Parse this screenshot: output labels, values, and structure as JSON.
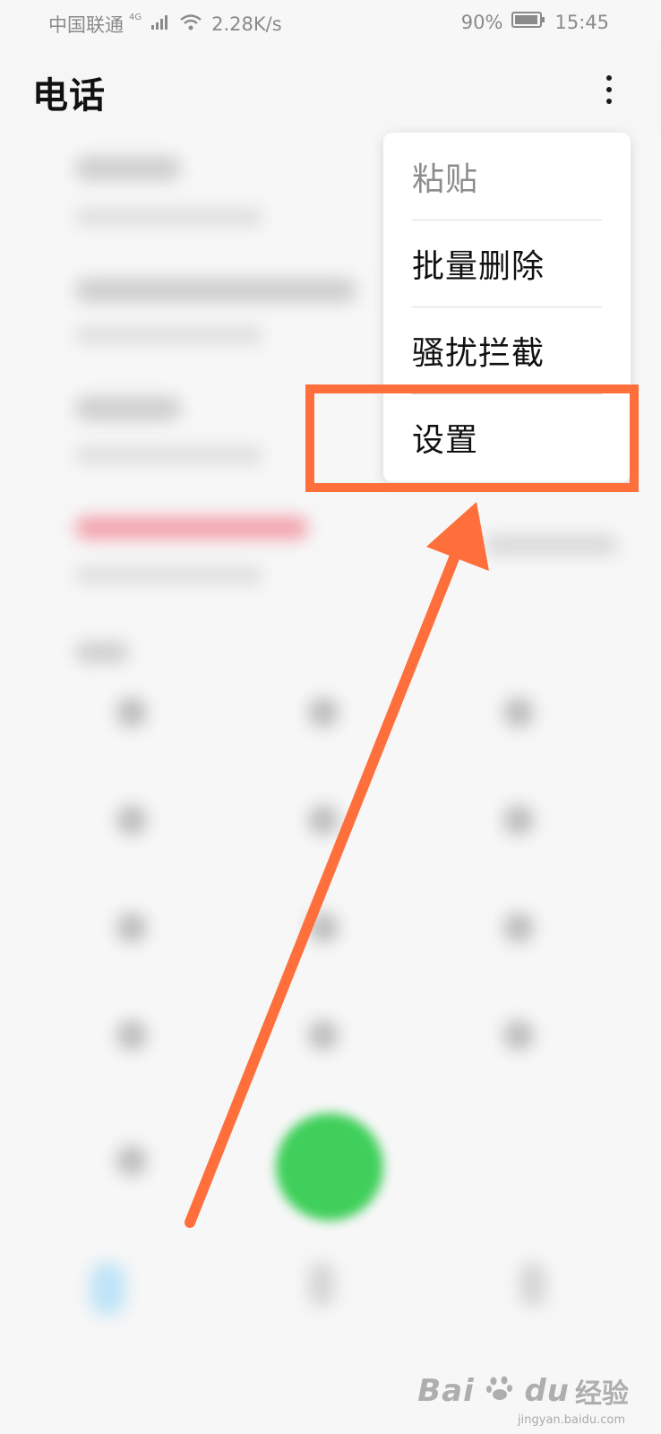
{
  "status_bar": {
    "carrier": "中国联通",
    "network_type": "4G",
    "speed": "2.28K/s",
    "battery": "90%",
    "time": "15:45"
  },
  "header": {
    "title": "电话",
    "more_icon": "more-vertical-icon"
  },
  "menu": {
    "items": [
      {
        "label": "粘贴",
        "enabled": false
      },
      {
        "label": "批量删除",
        "enabled": true
      },
      {
        "label": "骚扰拦截",
        "enabled": true
      },
      {
        "label": "设置",
        "enabled": true
      }
    ]
  },
  "annotation": {
    "color": "#ff6f3c",
    "target": "设置"
  },
  "colors": {
    "call_button": "#3fcf5a",
    "annotation": "#ff6f3c"
  },
  "watermark": {
    "brand": "Bai",
    "brand_suffix": "du",
    "product": "经验",
    "url": "jingyan.baidu.com"
  }
}
